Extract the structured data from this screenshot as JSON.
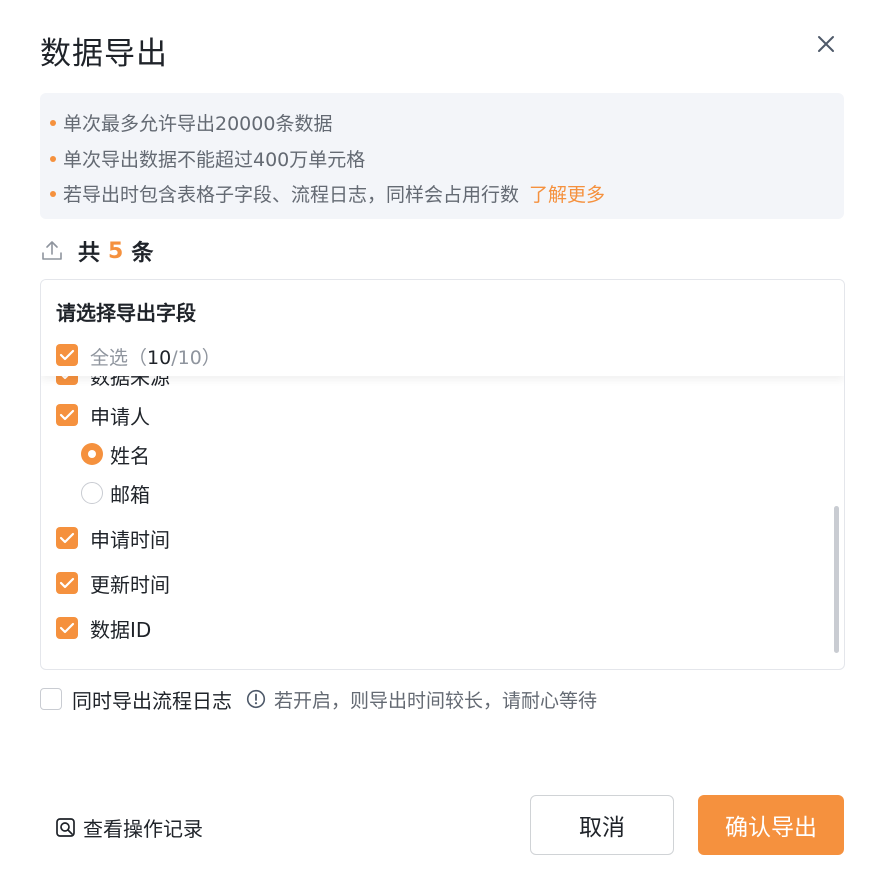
{
  "dialog": {
    "title": "数据导出",
    "close_icon": "close-icon"
  },
  "notice": {
    "lines": [
      "单次最多允许导出20000条数据",
      "单次导出数据不能超过400万单元格",
      "若导出时包含表格子字段、流程日志，同样会占用行数"
    ],
    "learn_more": "了解更多"
  },
  "summary": {
    "prefix": "共",
    "count": "5",
    "suffix": "条",
    "icon": "upload-icon"
  },
  "fields": {
    "title": "请选择导出字段",
    "select_all_label": "全选",
    "select_all_count_open": "（",
    "select_all_count_selected": "10",
    "select_all_count_total": "/10）",
    "partial_item": "数据来源",
    "items": [
      {
        "label": "申请人",
        "checked": true
      },
      {
        "label": "申请时间",
        "checked": true
      },
      {
        "label": "更新时间",
        "checked": true
      },
      {
        "label": "数据ID",
        "checked": true
      }
    ],
    "applicant_options": [
      {
        "label": "姓名",
        "selected": true
      },
      {
        "label": "邮箱",
        "selected": false
      }
    ]
  },
  "log_export": {
    "label": "同时导出流程日志",
    "checked": false,
    "hint": "若开启，则导出时间较长，请耐心等待",
    "hint_icon": "info-icon"
  },
  "footer": {
    "history_label": "查看操作记录",
    "history_icon": "search-record-icon",
    "cancel_label": "取消",
    "confirm_label": "确认导出"
  },
  "colors": {
    "accent": "#f5913e",
    "notice_bg": "#f3f5f9",
    "text_primary": "#1f2329",
    "text_secondary": "#646a73"
  }
}
